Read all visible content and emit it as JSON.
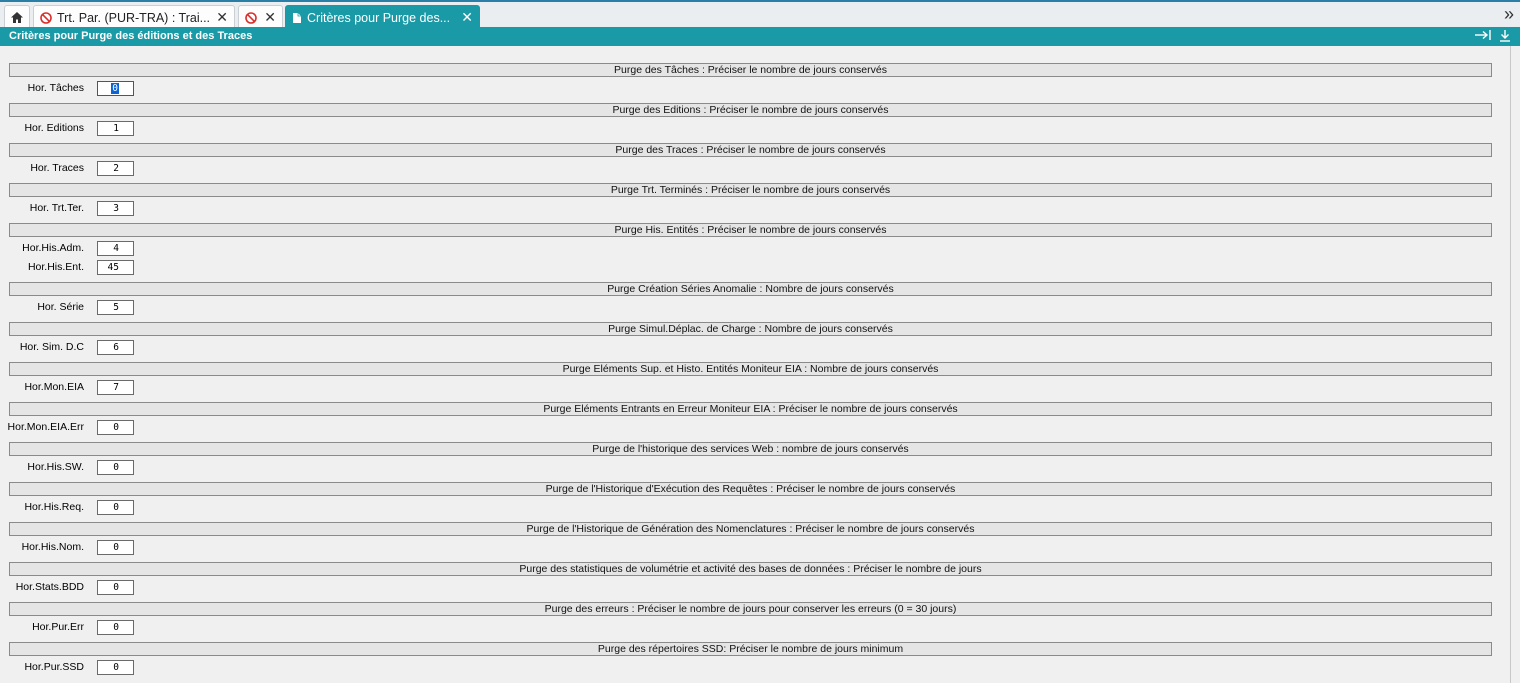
{
  "tabs": [
    {
      "label": "",
      "icon": "home-icon",
      "closable": false
    },
    {
      "label": "Trt. Par. (PUR-TRA) : Trai...",
      "icon": "no-entry-icon",
      "closable": true
    },
    {
      "label": "",
      "icon": "no-entry-icon",
      "closable": true
    },
    {
      "label": "Critères pour Purge des...",
      "icon": "document-icon",
      "closable": true,
      "active": true
    }
  ],
  "window": {
    "title": "Critères pour Purge des éditions et des Traces"
  },
  "colors": {
    "accent": "#1a9aa6",
    "selection": "#0a64d8"
  },
  "sections": [
    {
      "header": "Purge des Tâches : Préciser le nombre de jours conservés",
      "fields": [
        {
          "label": "Hor. Tâches",
          "value": "0",
          "selected": true
        }
      ]
    },
    {
      "header": "Purge des Editions : Préciser le nombre de jours conservés",
      "fields": [
        {
          "label": "Hor. Editions",
          "value": "1"
        }
      ]
    },
    {
      "header": "Purge des Traces : Préciser le nombre de jours conservés",
      "fields": [
        {
          "label": "Hor. Traces",
          "value": "2"
        }
      ]
    },
    {
      "header": "Purge Trt. Terminés : Préciser le nombre de jours conservés",
      "fields": [
        {
          "label": "Hor. Trt.Ter.",
          "value": "3"
        }
      ]
    },
    {
      "header": "Purge His. Entités : Préciser le nombre de jours conservés",
      "fields": [
        {
          "label": "Hor.His.Adm.",
          "value": "4"
        },
        {
          "label": "Hor.His.Ent.",
          "value": "45"
        }
      ]
    },
    {
      "header": "Purge Création Séries Anomalie : Nombre de jours conservés",
      "fields": [
        {
          "label": "Hor. Série",
          "value": "5"
        }
      ]
    },
    {
      "header": "Purge Simul.Déplac. de Charge : Nombre de jours conservés",
      "fields": [
        {
          "label": "Hor. Sim. D.C",
          "value": "6"
        }
      ]
    },
    {
      "header": "Purge Eléments Sup. et Histo. Entités Moniteur EIA : Nombre de jours conservés",
      "fields": [
        {
          "label": "Hor.Mon.EIA",
          "value": "7"
        }
      ]
    },
    {
      "header": "Purge Eléments Entrants en Erreur Moniteur EIA : Préciser le nombre de jours conservés",
      "fields": [
        {
          "label": "Hor.Mon.EIA.Err",
          "value": "0"
        }
      ]
    },
    {
      "header": "Purge de l'historique des services Web : nombre de jours conservés",
      "fields": [
        {
          "label": "Hor.His.SW.",
          "value": "0"
        }
      ]
    },
    {
      "header": "Purge de l'Historique d'Exécution des Requêtes : Préciser le nombre de jours conservés",
      "fields": [
        {
          "label": "Hor.His.Req.",
          "value": "0"
        }
      ]
    },
    {
      "header": "Purge de l'Historique de Génération des Nomenclatures : Préciser le nombre de jours conservés",
      "fields": [
        {
          "label": "Hor.His.Nom.",
          "value": "0"
        }
      ]
    },
    {
      "header": "Purge des statistiques de volumétrie et activité des bases de données  : Préciser le nombre de jours",
      "fields": [
        {
          "label": "Hor.Stats.BDD",
          "value": "0"
        }
      ]
    },
    {
      "header": "Purge des erreurs : Préciser le nombre de jours pour conserver les erreurs (0 = 30 jours)",
      "fields": [
        {
          "label": "Hor.Pur.Err",
          "value": "0"
        }
      ]
    },
    {
      "header": "Purge des répertoires SSD: Préciser le nombre de jours minimum",
      "fields": [
        {
          "label": "Hor.Pur.SSD",
          "value": "0"
        }
      ]
    }
  ]
}
